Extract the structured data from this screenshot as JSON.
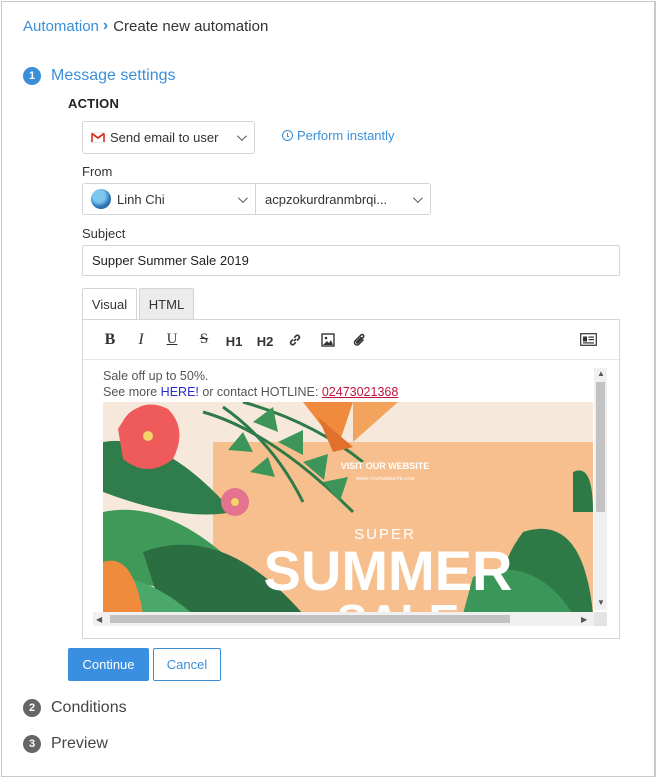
{
  "breadcrumb": {
    "root": "Automation",
    "separator": "›",
    "current": "Create new automation"
  },
  "steps": [
    {
      "number": "1",
      "title": "Message settings",
      "state": "active"
    },
    {
      "number": "2",
      "title": "Conditions",
      "state": "idle"
    },
    {
      "number": "3",
      "title": "Preview",
      "state": "idle"
    }
  ],
  "action": {
    "label": "ACTION",
    "type_value": "Send email to user",
    "type_icon": "gmail-icon",
    "perform_label": "Perform instantly"
  },
  "from": {
    "label": "From",
    "sender_name": "Linh Chi",
    "sender_email": "acpzokurdranmbrqi..."
  },
  "subject": {
    "label": "Subject",
    "value": "Supper Summer Sale 2019"
  },
  "editor": {
    "tabs": [
      {
        "label": "Visual",
        "active": true
      },
      {
        "label": "HTML",
        "active": false
      }
    ],
    "toolbar": {
      "bold": "B",
      "italic": "I",
      "underline": "U",
      "strike": "S",
      "h1": "H1",
      "h2": "H2"
    },
    "body": {
      "line1": "Sale off up to 50%.",
      "line2_prefix": "See more ",
      "here_link": "HERE!",
      "line2_middle": " or contact HOTLINE: ",
      "hotline": "02473021368"
    },
    "banner": {
      "visit": "VISIT OUR WEBSITE",
      "site": "WWW.YOURWEBSITE.COM",
      "super": "SUPER",
      "summer": "SUMMER",
      "sale": "SALE"
    }
  },
  "buttons": {
    "continue": "Continue",
    "cancel": "Cancel"
  },
  "colors": {
    "accent": "#3b8fd8",
    "banner_peach": "#f7bf8e",
    "hotline": "#c0143c"
  }
}
